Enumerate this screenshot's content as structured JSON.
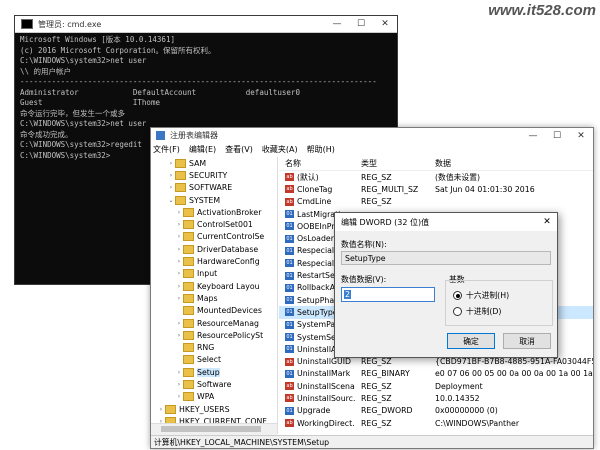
{
  "watermark": "www.it528.com",
  "cmd": {
    "title": "管理员: cmd.exe",
    "controls": [
      "—",
      "☐",
      "✕"
    ],
    "lines": [
      "Microsoft Windows [版本 10.0.14361]",
      "(c) 2016 Microsoft Corporation。保留所有权利。",
      "",
      "C:\\WINDOWS\\system32>net user",
      "",
      "\\\\ 的用户帐户",
      "",
      "-------------------------------------------------------------------------------",
      "Administrator            DefaultAccount           defaultuser0",
      "Guest                    IThome",
      "命令运行完毕，但发生一个或多",
      "",
      "C:\\WINDOWS\\system32>net user",
      "命令成功完成。",
      "",
      "C:\\WINDOWS\\system32>regedit",
      "",
      "C:\\WINDOWS\\system32>"
    ]
  },
  "regedit": {
    "title": "注册表编辑器",
    "controls": [
      "—",
      "☐",
      "✕"
    ],
    "menu": [
      "文件(F)",
      "编辑(E)",
      "查看(V)",
      "收藏夹(A)",
      "帮助(H)"
    ],
    "tree": [
      {
        "label": "SAM",
        "arrow": "›"
      },
      {
        "label": "SECURITY",
        "arrow": "›"
      },
      {
        "label": "SOFTWARE",
        "arrow": "›"
      },
      {
        "label": "SYSTEM",
        "arrow": "⌄"
      },
      {
        "label": "ActivationBroker",
        "arrow": "›"
      },
      {
        "label": "ControlSet001",
        "arrow": "›"
      },
      {
        "label": "CurrentControlSe",
        "arrow": "›"
      },
      {
        "label": "DriverDatabase",
        "arrow": "›"
      },
      {
        "label": "HardwareConfig",
        "arrow": "›"
      },
      {
        "label": "Input",
        "arrow": "›"
      },
      {
        "label": "Keyboard Layou",
        "arrow": "›"
      },
      {
        "label": "Maps",
        "arrow": "›"
      },
      {
        "label": "MountedDevices",
        "arrow": ""
      },
      {
        "label": "ResourceManag",
        "arrow": "›"
      },
      {
        "label": "ResourcePolicySt",
        "arrow": "›"
      },
      {
        "label": "RNG",
        "arrow": ""
      },
      {
        "label": "Select",
        "arrow": ""
      },
      {
        "label": "Setup",
        "arrow": "›"
      },
      {
        "label": "Software",
        "arrow": "›"
      },
      {
        "label": "WPA",
        "arrow": "›"
      },
      {
        "label": "HKEY_USERS",
        "arrow": "›"
      },
      {
        "label": "HKEY_CURRENT_CONF",
        "arrow": "›"
      }
    ],
    "columns": {
      "name": "名称",
      "type": "类型",
      "data": "数据"
    },
    "values": [
      {
        "icon": "sz",
        "name": "(默认)",
        "type": "REG_SZ",
        "data": "(数值未设置)"
      },
      {
        "icon": "sz",
        "name": "CloneTag",
        "type": "REG_MULTI_SZ",
        "data": "Sat Jun 04 01:01:30 2016"
      },
      {
        "icon": "sz",
        "name": "CmdLine",
        "type": "REG_SZ",
        "data": ""
      },
      {
        "icon": "dword",
        "name": "LastMigratio",
        "type": "",
        "data": ""
      },
      {
        "icon": "dword",
        "name": "OOBEInProgr",
        "type": "",
        "data": ""
      },
      {
        "icon": "dword",
        "name": "OsLoaderPat",
        "type": "",
        "data": ""
      },
      {
        "icon": "dword",
        "name": "Respecialize",
        "type": "",
        "data": ""
      },
      {
        "icon": "dword",
        "name": "Respecialize",
        "type": "",
        "data": ""
      },
      {
        "icon": "dword",
        "name": "RestartSetu",
        "type": "",
        "data": ""
      },
      {
        "icon": "dword",
        "name": "RollbackAct",
        "type": "",
        "data": ""
      },
      {
        "icon": "dword",
        "name": "SetupPhase",
        "type": "",
        "data": ""
      },
      {
        "icon": "dword",
        "name": "SetupType",
        "type": "",
        "data": ""
      },
      {
        "icon": "dword",
        "name": "SystemParti",
        "type": "",
        "data": ""
      },
      {
        "icon": "dword",
        "name": "SystemSetu",
        "type": "",
        "data": ""
      },
      {
        "icon": "dword",
        "name": "UninstallAct",
        "type": "",
        "data": ""
      },
      {
        "icon": "sz",
        "name": "UninstallGUID",
        "type": "REG_SZ",
        "data": "{CBD971BF-B7B8-4885-951A-FA03044F5D71}"
      },
      {
        "icon": "dword",
        "name": "UninstallMark",
        "type": "REG_BINARY",
        "data": "e0 07 06 00 05 00 0a 00 0a 00 1a 00 1a 03 0a 00 bf..."
      },
      {
        "icon": "sz",
        "name": "UninstallScena...",
        "type": "REG_SZ",
        "data": "Deployment"
      },
      {
        "icon": "sz",
        "name": "UninstallSourc...",
        "type": "REG_SZ",
        "data": "10.0.14352"
      },
      {
        "icon": "dword",
        "name": "Upgrade",
        "type": "REG_DWORD",
        "data": "0x00000000 (0)"
      },
      {
        "icon": "sz",
        "name": "WorkingDirect...",
        "type": "REG_SZ",
        "data": "C:\\WINDOWS\\Panther"
      }
    ],
    "status": "计算机\\HKEY_LOCAL_MACHINE\\SYSTEM\\Setup"
  },
  "dialog": {
    "title": "编辑 DWORD (32 位)值",
    "close": "✕",
    "name_label": "数值名称(N):",
    "name_value": "SetupType",
    "data_label": "数值数据(V):",
    "data_value": "2",
    "base_label": "基数",
    "hex_label": "十六进制(H)",
    "dec_label": "十进制(D)",
    "selected_base": "hex",
    "ok": "确定",
    "cancel": "取消"
  }
}
